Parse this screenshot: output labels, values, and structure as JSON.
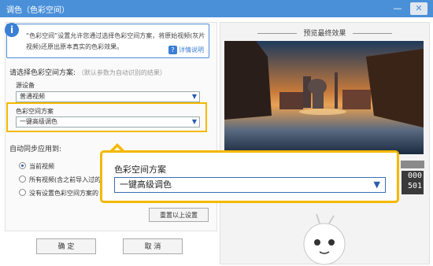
{
  "window": {
    "title": "调色（色彩空间）",
    "minimize": "—",
    "close": "✕"
  },
  "info": {
    "icon": "i",
    "text": "“色彩空间”设置允许您通过选择色彩空间方案，将原始视频(灰片视频)还原出原本真实的色彩效果。",
    "help_icon": "?",
    "help_label": "详情说明"
  },
  "scheme_section": {
    "label": "请选择色彩空间方案:",
    "hint": "（默认参数为自动识别的结果）"
  },
  "source_device": {
    "label": "源设备",
    "value": "普通视频"
  },
  "color_scheme": {
    "label": "色彩空间方案",
    "value": "一键高级调色"
  },
  "sync": {
    "label": "自动同步应用到:",
    "options": [
      {
        "label": "当前视频",
        "selected": true
      },
      {
        "label": "所有视频(含之前导入过的",
        "selected": false
      },
      {
        "label": "没有设置色彩空间方案的",
        "selected": false
      }
    ]
  },
  "reset_button": "重置以上设置",
  "ok_button": "确 定",
  "cancel_button": "取 消",
  "preview": {
    "title": "预览最终效果",
    "timecode_line1": "000",
    "timecode_line2": "501"
  },
  "callout": {
    "label": "色彩空间方案",
    "value": "一键高级调色"
  },
  "colors": {
    "accent": "#4a90d9",
    "highlight": "#f5b800",
    "link": "#3a7fd5"
  },
  "icons": [
    "info-icon",
    "help-icon",
    "chevron-down-icon",
    "close-icon",
    "minimize-icon",
    "mascot-icon"
  ]
}
